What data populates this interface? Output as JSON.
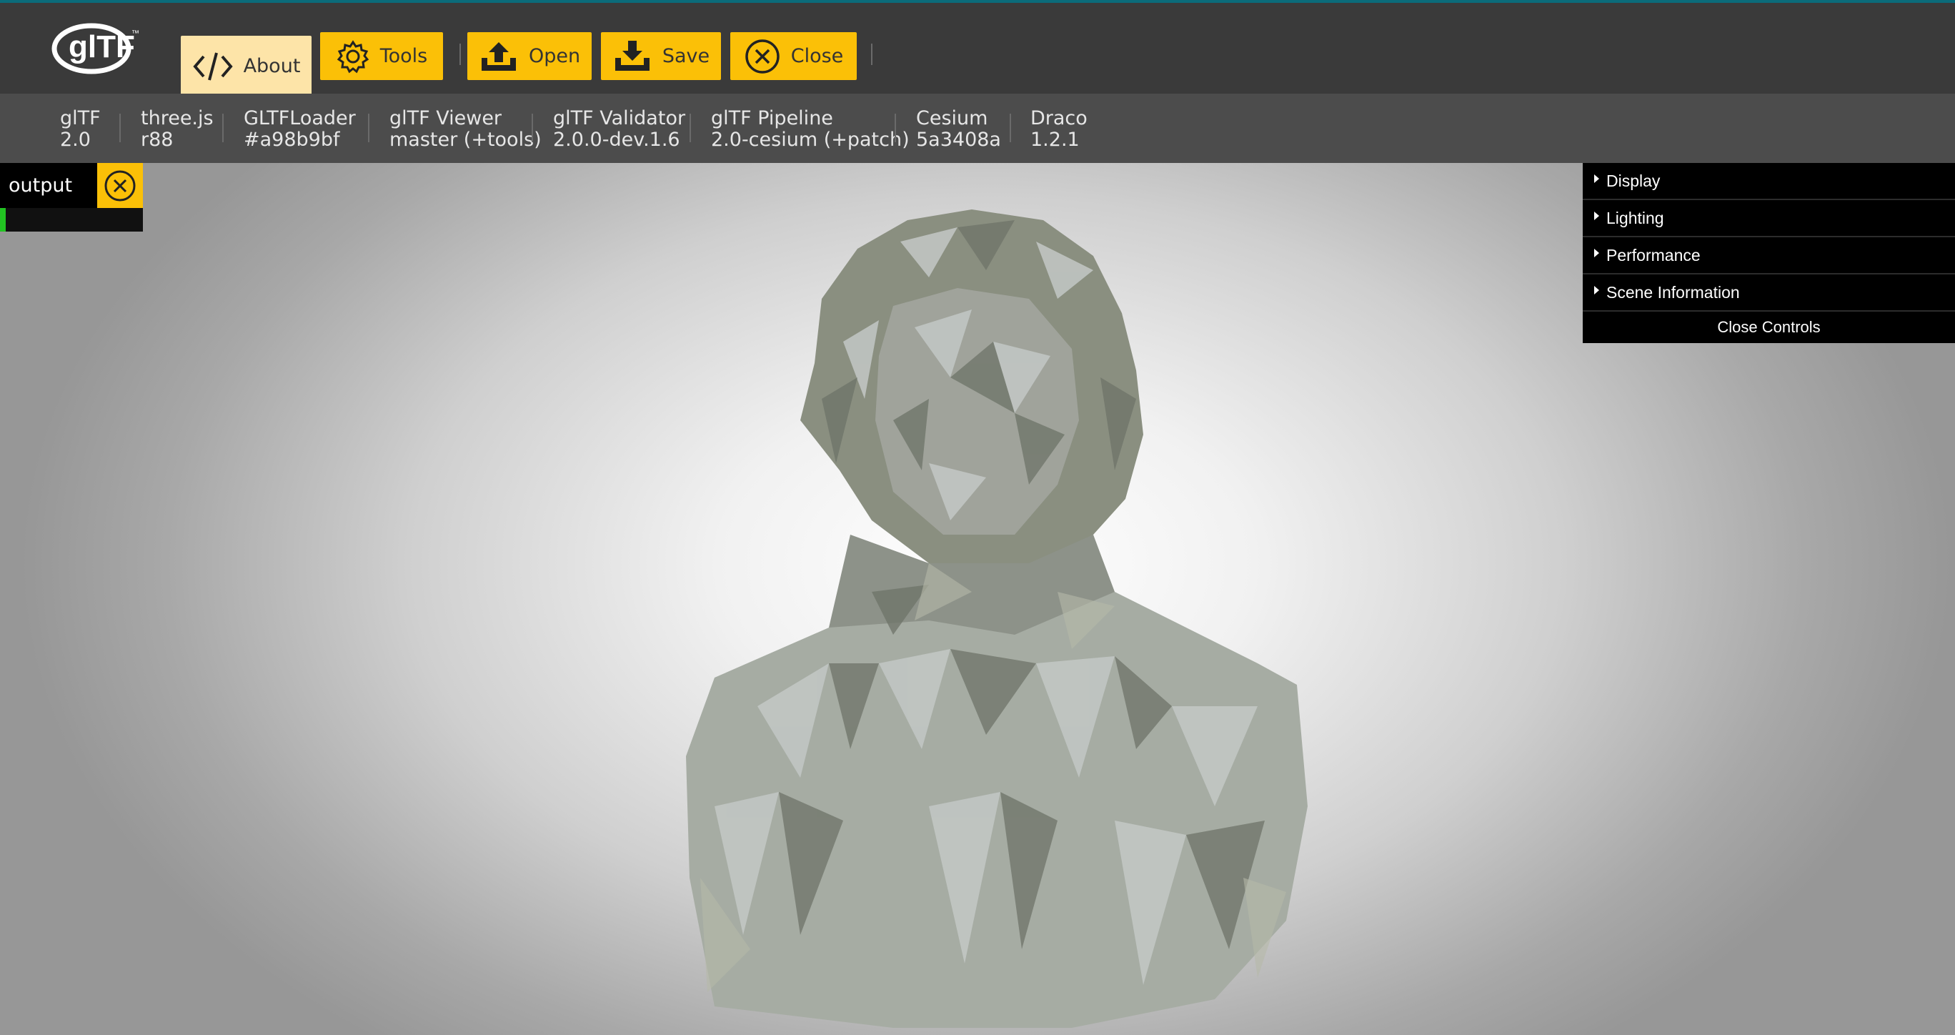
{
  "toolbar": {
    "logo_text": "glTF",
    "buttons": [
      {
        "label": "About",
        "icon": "code-icon"
      },
      {
        "label": "Tools",
        "icon": "gear-icon"
      },
      {
        "label": "Open",
        "icon": "upload-icon"
      },
      {
        "label": "Save",
        "icon": "download-icon"
      },
      {
        "label": "Close",
        "icon": "close-circle-icon"
      }
    ]
  },
  "versions": [
    {
      "name": "glTF",
      "value": "2.0"
    },
    {
      "name": "three.js",
      "value": "r88"
    },
    {
      "name": "GLTFLoader",
      "value": "#a98b9bf"
    },
    {
      "name": "glTF Viewer",
      "value": "master (+tools)"
    },
    {
      "name": "glTF Validator",
      "value": "2.0.0-dev.1.6"
    },
    {
      "name": "glTF Pipeline",
      "value": "2.0-cesium (+patch)"
    },
    {
      "name": "Cesium",
      "value": "5a3408a"
    },
    {
      "name": "Draco",
      "value": "1.2.1"
    }
  ],
  "output": {
    "label": "output",
    "progress_fraction": 0.04
  },
  "controls": {
    "folders": [
      "Display",
      "Lighting",
      "Performance",
      "Scene Information"
    ],
    "close_label": "Close Controls"
  },
  "colors": {
    "accent": "#fbc007",
    "active_tab": "#fde4a8",
    "header_bg": "#3a3a3a",
    "version_bg": "#4c4c4c",
    "progress": "#22c322"
  }
}
